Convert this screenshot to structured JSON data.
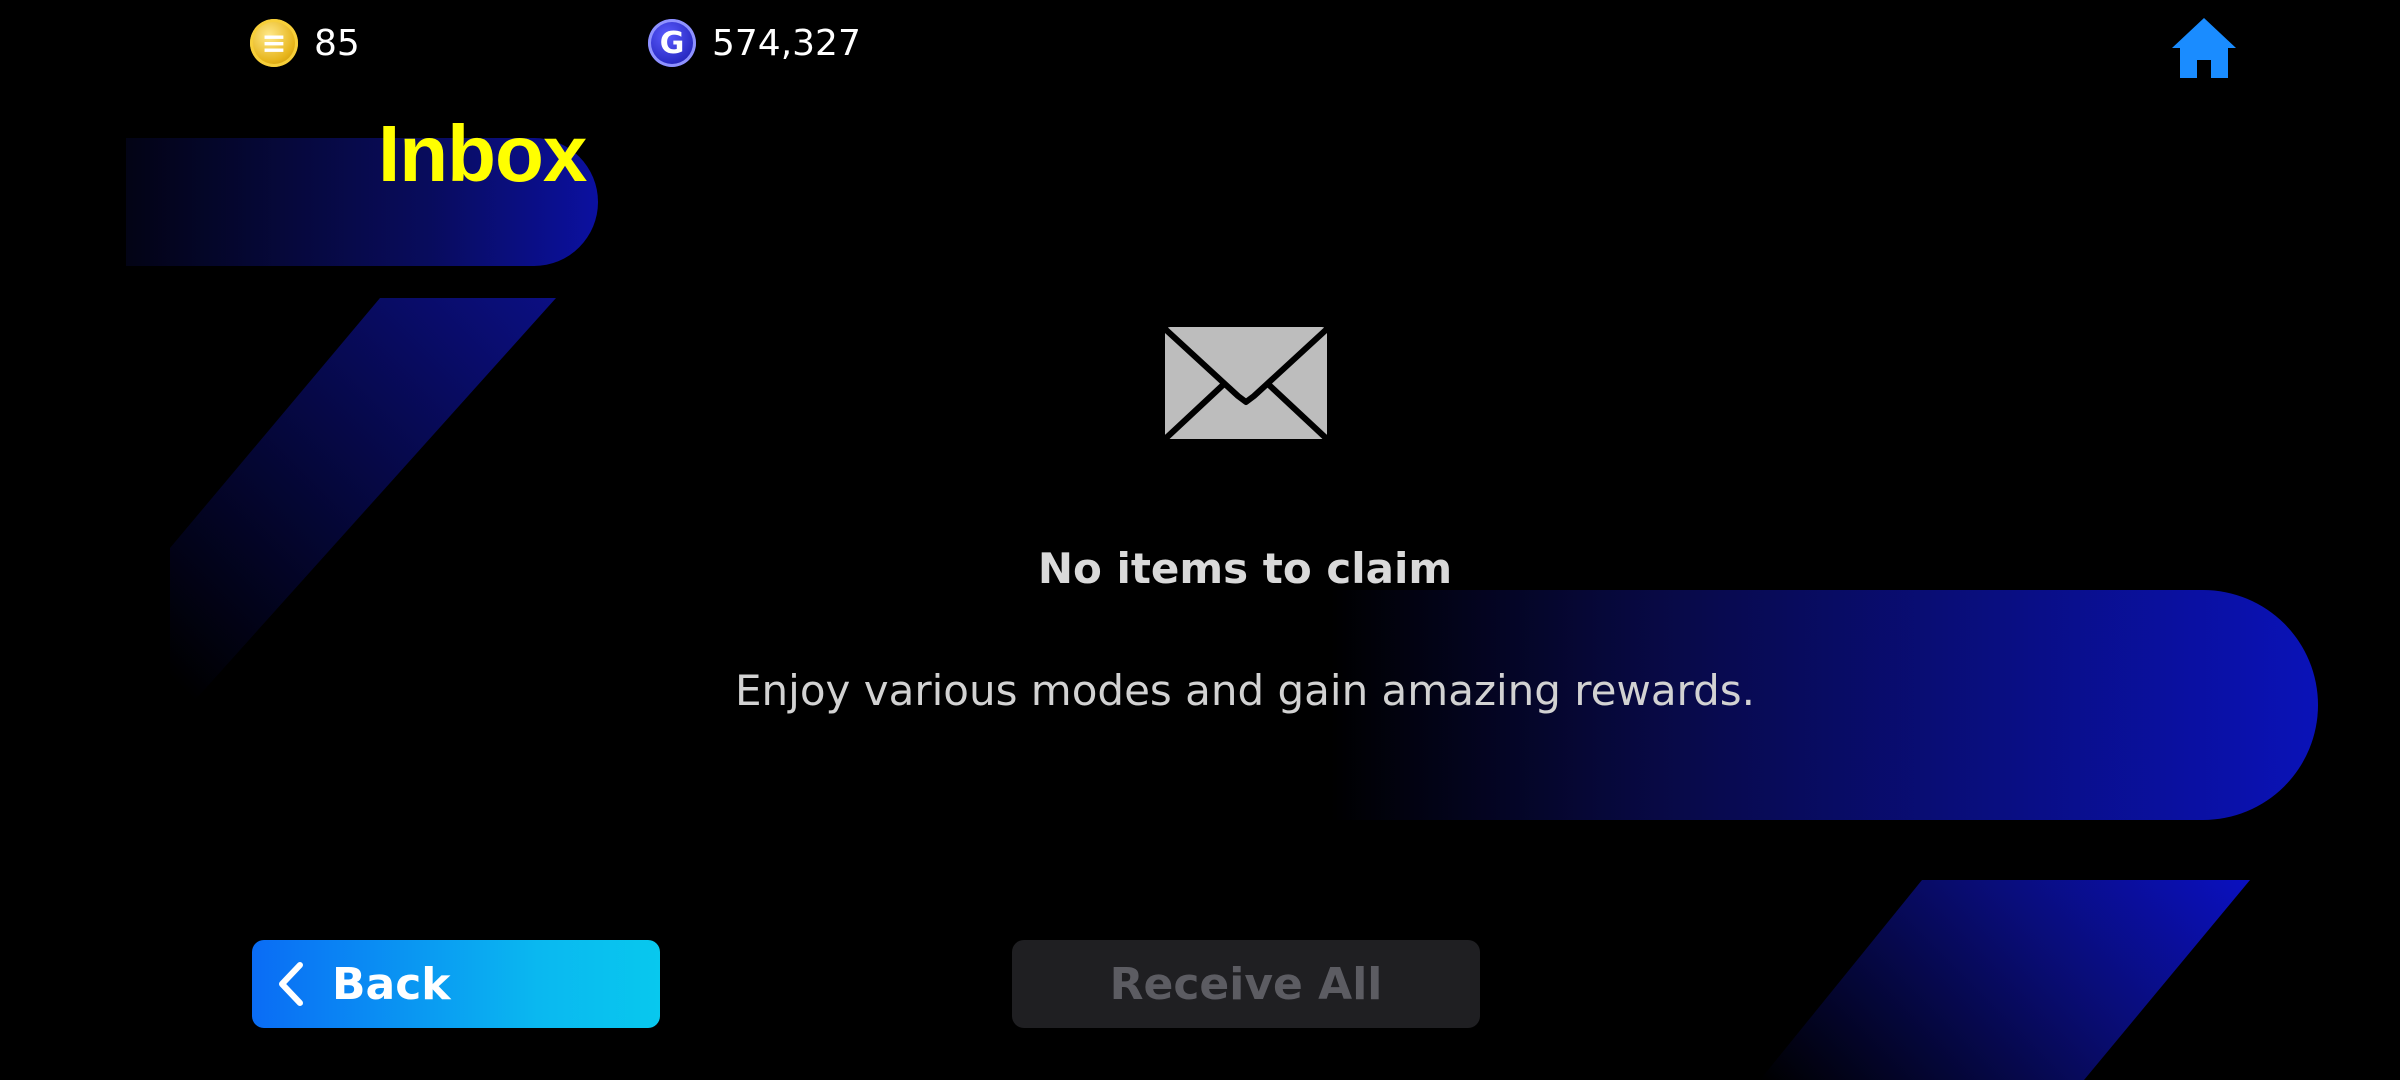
{
  "currencies": {
    "coins": {
      "value": "85",
      "icon": "coin-icon",
      "symbol": "≡"
    },
    "gp": {
      "value": "574,327",
      "icon": "gp-icon",
      "symbol": "G"
    }
  },
  "header": {
    "title": "Inbox",
    "home_icon": "home-icon"
  },
  "empty_state": {
    "icon": "envelope-icon",
    "title": "No items to claim",
    "description": "Enjoy various modes and gain amazing rewards."
  },
  "footer": {
    "back_label": "Back",
    "back_icon": "chevron-left-icon",
    "receive_all_label": "Receive All",
    "receive_all_enabled": false
  },
  "colors": {
    "title": "#ffff00",
    "accent_blue": "#0a6cf5",
    "accent_cyan": "#08c8ee",
    "home_icon": "#1a8cff",
    "disabled_button_bg": "#1f1f22",
    "disabled_button_text": "#5c5c62",
    "background": "#000000"
  }
}
